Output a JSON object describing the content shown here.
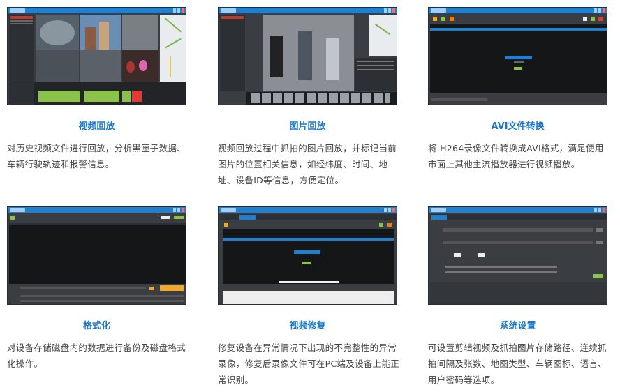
{
  "features": [
    {
      "title": "视频回放",
      "desc": "对历史视频文件进行回放，分析黑匣子数据、车辆行驶轨迹和报警信息。"
    },
    {
      "title": "图片回放",
      "desc": "视频回放过程中抓拍的图片回放，并标记当前图片的位置相关信息，如经纬度、时间、地址、设备ID等信息，方便定位。"
    },
    {
      "title": "AVI文件转换",
      "desc": "将.H264录像文件转换成AVI格式，满足使用市面上其他主流播放器进行视频播放。"
    },
    {
      "title": "格式化",
      "desc": "对设备存储磁盘内的数据进行备份及磁盘格式化操作。"
    },
    {
      "title": "视频修复",
      "desc": "修复设备在异常情况下出现的不完整性的异常录像，修复后录像文件可在PC端及设备上能正常识别。"
    },
    {
      "title": "系统设置",
      "desc": "可设置剪辑视频及抓拍图片存储路径、连续抓拍间隔及张数、地图类型、车辆图标、语言、用户密码等选项。"
    }
  ],
  "colors": {
    "accent": "#1a77c9",
    "titlebar": "#1f7fd0",
    "panel_dark": "#151618",
    "panel_mid": "#3a3d42",
    "timeline_green": "#8bc34a",
    "timeline_red": "#e53935",
    "button_orange": "#f5a623"
  }
}
